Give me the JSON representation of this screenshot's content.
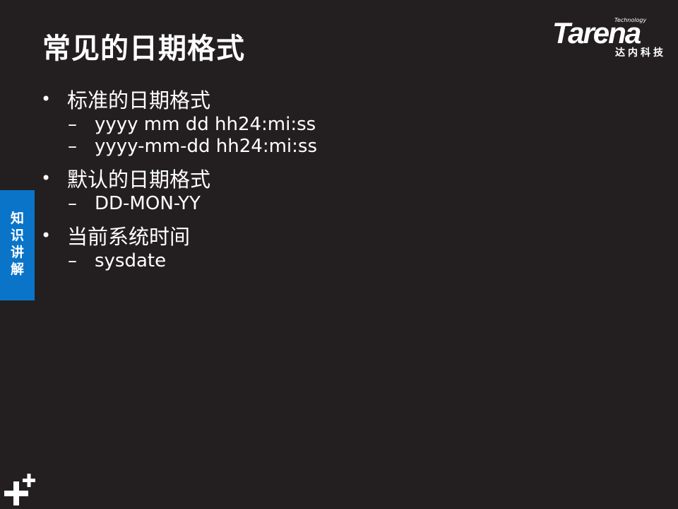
{
  "slide": {
    "title": "常见的日期格式"
  },
  "logo": {
    "technology": "Technology",
    "brand": "Tarena",
    "chinese": "达内科技"
  },
  "side_tab": {
    "label": "知\n识\n讲\n解"
  },
  "bullets": [
    {
      "bullet": "•",
      "text": "标准的日期格式",
      "subs": [
        {
          "dash": "–",
          "text": "yyyy mm dd hh24:mi:ss"
        },
        {
          "dash": "–",
          "text": "yyyy-mm-dd hh24:mi:ss"
        }
      ]
    },
    {
      "bullet": "•",
      "text": "默认的日期格式",
      "subs": [
        {
          "dash": "–",
          "text": "DD-MON-YY"
        }
      ]
    },
    {
      "bullet": "•",
      "text": "当前系统时间",
      "subs": [
        {
          "dash": "–",
          "text": "sysdate"
        }
      ]
    }
  ],
  "colors": {
    "background": "#231f20",
    "text": "#ffffff",
    "side_tab": "#0a74c9"
  },
  "icons": {
    "corner": "plus-decoration-icon"
  }
}
